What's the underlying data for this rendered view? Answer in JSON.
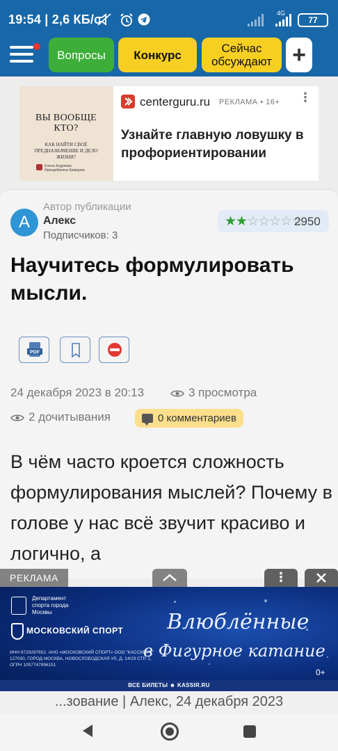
{
  "status_bar": {
    "time": "19:54",
    "speed": "2,6 КБ/с",
    "network": "4G",
    "battery": "77"
  },
  "appbar": {
    "tabs": [
      {
        "label": "Вопросы"
      },
      {
        "label": "Конкурс"
      },
      {
        "label": "Сейчас обсуждают"
      }
    ],
    "add_label": "+"
  },
  "ad_top": {
    "book_title": "ВЫ ВООБЩЕ КТО?",
    "book_subtitle": "КАК НАЙТИ СВОЁ ПРЕДНАЗНАЧЕНИЕ И ДЕЛО ЖИЗНИ?",
    "book_author": "Елена Андреева Ириндибаевна Кравцова",
    "domain": "centerguru.ru",
    "label": "РЕКЛАМА • 16+",
    "more": "⋮",
    "headline": "Узнайте главную ловушку в профориентировании"
  },
  "article": {
    "author_caption": "Автор публикации",
    "author_initial": "А",
    "author_name": "Алекс",
    "subscribers": "Подписчиков: 3",
    "rating_stars_filled": 2,
    "rating_stars_total": 7,
    "rating_value": "2950",
    "title": "Научитесь формулировать мысли.",
    "date": "24 декабря 2023 в 20:13",
    "views": "3 просмотра",
    "reads": "2 дочитывания",
    "comments": "0 комментариев",
    "body": "В чём часто кроется сложность формулирования мыслей? Почему в голове у нас всё звучит красиво и логично, а"
  },
  "ad_bottom": {
    "label": "РЕКЛАМА",
    "more": "⋮",
    "dept": "Департамент спорта города Москвы",
    "sport": "МОСКОВСКИЙ СПОРТ",
    "legal": "ИНН 9729297652. АНО «МОСКОВСКИЙ СПОРТ» ООО \"КАССИР.РУ\" 127030, ГОРОД МОСКВА, НОВОСЛОБОДСКАЯ УЛ, Д. 14/19 СТР. 1, ОГРН 1057747996151",
    "script_line1": "Влюблённые",
    "script_line2": "в Фигурное катание",
    "age": "0+",
    "tickets": "ВСЕ БИЛЕТЫ ☻ KASSIR.RU"
  },
  "footer": {
    "text": "...зование | Алекс, 24 декабря 2023"
  },
  "colors": {
    "header_blue": "#1867a8",
    "green": "#3cae39",
    "yellow": "#f7cf23"
  }
}
